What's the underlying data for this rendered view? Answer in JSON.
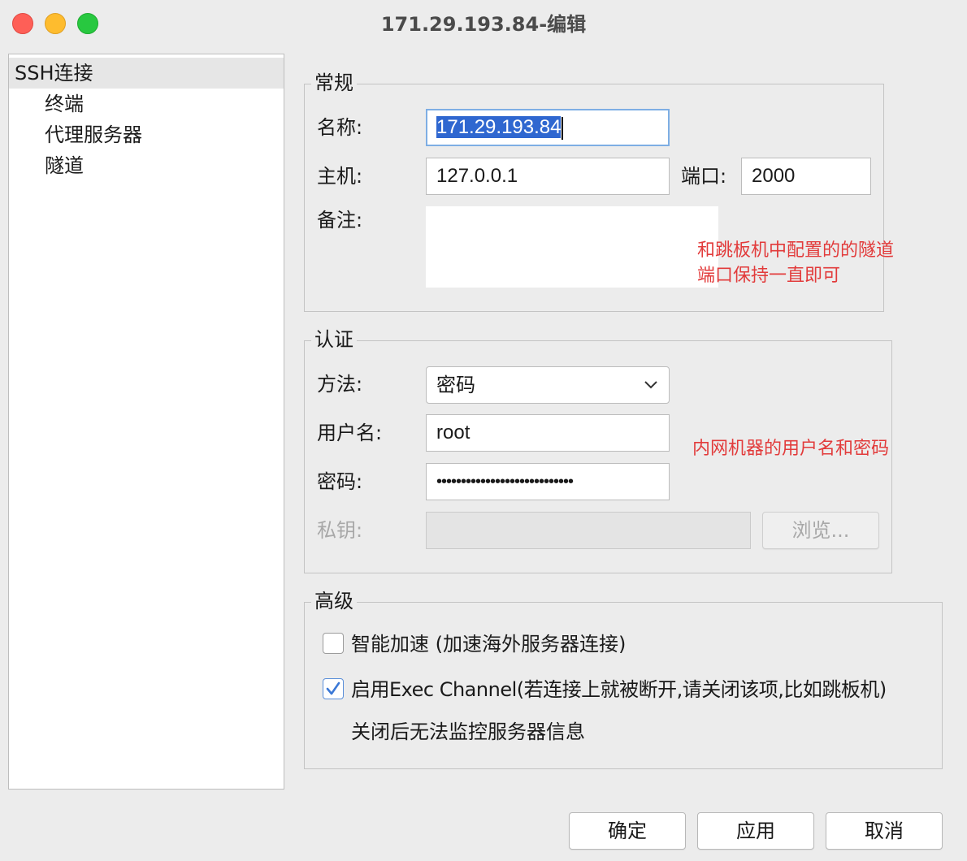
{
  "window": {
    "title": "171.29.193.84-编辑"
  },
  "sidebar": {
    "items": [
      {
        "label": "SSH连接",
        "selected": true
      },
      {
        "label": "终端"
      },
      {
        "label": "代理服务器"
      },
      {
        "label": "隧道"
      }
    ]
  },
  "general": {
    "legend": "常规",
    "name_label": "名称:",
    "name_value": "171.29.193.84",
    "host_label": "主机:",
    "host_value": "127.0.0.1",
    "port_label": "端口:",
    "port_value": "2000",
    "memo_label": "备注:",
    "memo_value": "",
    "note_line1": "和跳板机中配置的的隧道",
    "note_line2": "端口保持一直即可"
  },
  "auth": {
    "legend": "认证",
    "method_label": "方法:",
    "method_value": "密码",
    "username_label": "用户名:",
    "username_value": "root",
    "password_label": "密码:",
    "password_masked": "••••••••••••••••••••••••••••",
    "key_label": "私钥:",
    "key_value": "",
    "browse_label": "浏览...",
    "note": "内网机器的用户名和密码"
  },
  "advanced": {
    "legend": "高级",
    "smart_accel_label": "智能加速 (加速海外服务器连接)",
    "smart_accel_checked": false,
    "exec_channel_label": "启用Exec Channel(若连接上就被断开,请关闭该项,比如跳板机)",
    "exec_channel_checked": true,
    "exec_channel_hint": "关闭后无法监控服务器信息"
  },
  "footer": {
    "ok_label": "确定",
    "apply_label": "应用",
    "cancel_label": "取消"
  },
  "colors": {
    "annotation": "#e23b3b",
    "selection": "#2f67d0",
    "focus_ring": "#7eaee4",
    "check_accent": "#3b78d6"
  }
}
